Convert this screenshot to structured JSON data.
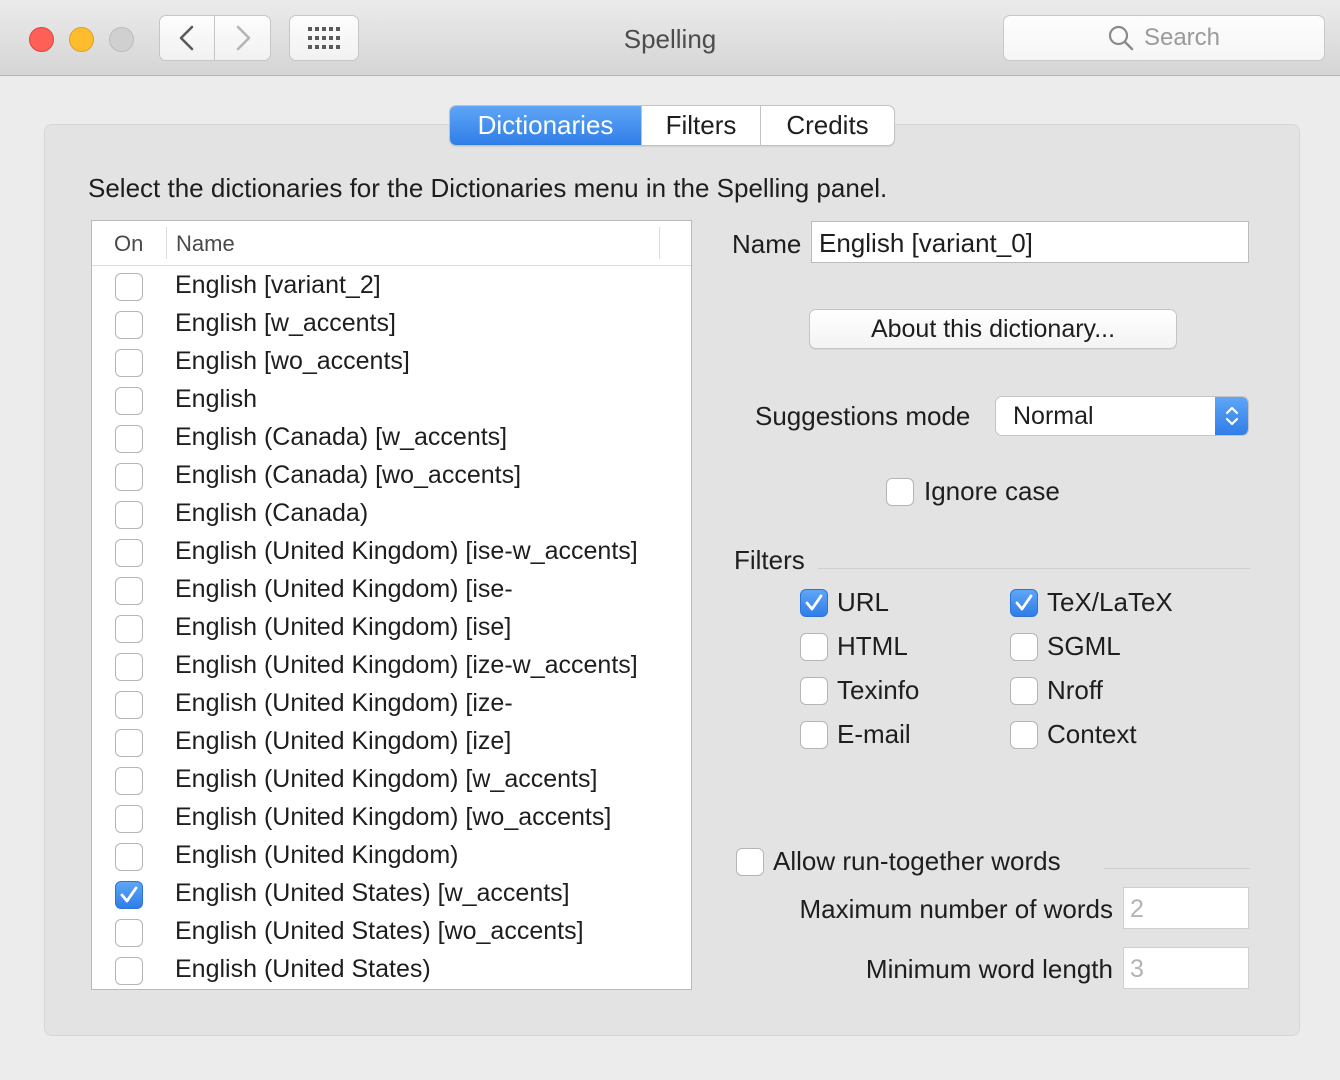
{
  "window": {
    "title": "Spelling",
    "search_placeholder": "Search",
    "icons": {
      "back": "chevron-left-icon",
      "forward": "chevron-right-icon",
      "show_all": "grid-icon",
      "search": "search-icon"
    }
  },
  "tabs": [
    {
      "label": "Dictionaries",
      "active": true
    },
    {
      "label": "Filters",
      "active": false
    },
    {
      "label": "Credits",
      "active": false
    }
  ],
  "instruction": "Select the dictionaries for the Dictionaries menu in the Spelling panel.",
  "dictionary_list": {
    "columns": {
      "on": "On",
      "name": "Name"
    },
    "rows": [
      {
        "name": "English [variant_2]",
        "on": false
      },
      {
        "name": "English [w_accents]",
        "on": false
      },
      {
        "name": "English [wo_accents]",
        "on": false
      },
      {
        "name": "English",
        "on": false
      },
      {
        "name": "English (Canada) [w_accents]",
        "on": false
      },
      {
        "name": "English (Canada) [wo_accents]",
        "on": false
      },
      {
        "name": "English (Canada)",
        "on": false
      },
      {
        "name": "English (United Kingdom) [ise-w_accents]",
        "on": false
      },
      {
        "name": "English (United Kingdom) [ise-",
        "on": false
      },
      {
        "name": "English (United Kingdom) [ise]",
        "on": false
      },
      {
        "name": "English (United Kingdom) [ize-w_accents]",
        "on": false
      },
      {
        "name": "English (United Kingdom) [ize-",
        "on": false
      },
      {
        "name": "English (United Kingdom) [ize]",
        "on": false
      },
      {
        "name": "English (United Kingdom) [w_accents]",
        "on": false
      },
      {
        "name": "English (United Kingdom) [wo_accents]",
        "on": false
      },
      {
        "name": "English (United Kingdom)",
        "on": false
      },
      {
        "name": "English (United States) [w_accents]",
        "on": true
      },
      {
        "name": "English (United States) [wo_accents]",
        "on": false
      },
      {
        "name": "English (United States)",
        "on": false
      }
    ]
  },
  "details": {
    "name_label": "Name",
    "name_value": "English [variant_0]",
    "about_button": "About this dictionary...",
    "suggestions_label": "Suggestions mode",
    "suggestions_value": "Normal",
    "ignore_case_label": "Ignore case",
    "ignore_case_checked": false
  },
  "filters": {
    "title": "Filters",
    "url": {
      "label": "URL",
      "checked": true
    },
    "tex": {
      "label": "TeX/LaTeX",
      "checked": true
    },
    "html": {
      "label": "HTML",
      "checked": false
    },
    "sgml": {
      "label": "SGML",
      "checked": false
    },
    "texinfo": {
      "label": "Texinfo",
      "checked": false
    },
    "nroff": {
      "label": "Nroff",
      "checked": false
    },
    "email": {
      "label": "E-mail",
      "checked": false
    },
    "context": {
      "label": "Context",
      "checked": false
    }
  },
  "run_together": {
    "label": "Allow run-together words",
    "checked": false,
    "max_words_label": "Maximum number of words",
    "max_words_value": "2",
    "min_length_label": "Minimum word length",
    "min_length_value": "3"
  },
  "colors": {
    "accent": "#2f7de8",
    "close": "#fe5f57",
    "minimize": "#febc2e",
    "disabled_text": "#b3b3b3"
  }
}
